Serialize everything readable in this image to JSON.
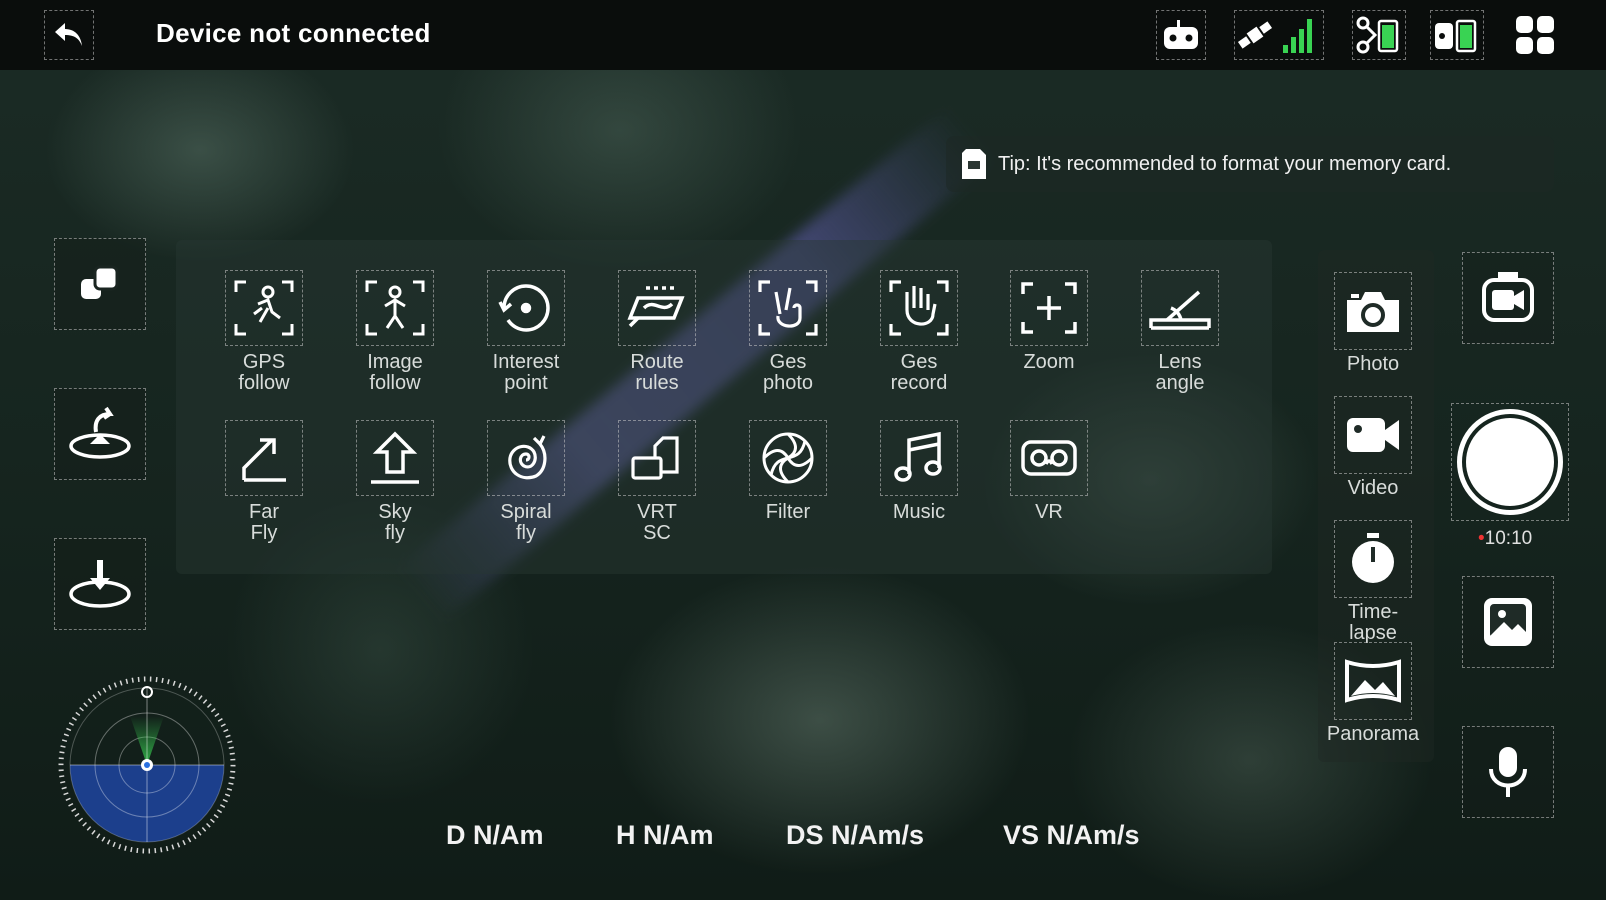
{
  "header": {
    "title": "Device not connected"
  },
  "top_icons": [
    "remote-controller-icon",
    "satellite-signal-icon",
    "drone-battery-icon",
    "controller-battery-icon",
    "grid-menu-icon"
  ],
  "tip": {
    "text": "Tip: It's recommended to format your memory card."
  },
  "left_buttons": [
    "switch-view-icon",
    "return-home-icon",
    "landing-icon"
  ],
  "modes": [
    {
      "label": "GPS\nfollow",
      "icon": "gps-follow-icon"
    },
    {
      "label": "Image\nfollow",
      "icon": "image-follow-icon"
    },
    {
      "label": "Interest\npoint",
      "icon": "interest-point-icon"
    },
    {
      "label": "Route\nrules",
      "icon": "route-rules-icon"
    },
    {
      "label": "Ges\nphoto",
      "icon": "gesture-photo-icon"
    },
    {
      "label": "Ges\nrecord",
      "icon": "gesture-record-icon"
    },
    {
      "label": "Zoom",
      "icon": "zoom-icon"
    },
    {
      "label": "Lens\nangle",
      "icon": "lens-angle-icon"
    },
    {
      "label": "Far\nFly",
      "icon": "far-fly-icon"
    },
    {
      "label": "Sky\nfly",
      "icon": "sky-fly-icon"
    },
    {
      "label": "Spiral\nfly",
      "icon": "spiral-fly-icon"
    },
    {
      "label": "VRT\nSC",
      "icon": "vrt-sc-icon"
    },
    {
      "label": "Filter",
      "icon": "filter-icon"
    },
    {
      "label": "Music",
      "icon": "music-icon"
    },
    {
      "label": "VR",
      "icon": "vr-icon"
    }
  ],
  "camera_modes": [
    {
      "label": "Photo",
      "icon": "camera-icon"
    },
    {
      "label": "Video",
      "icon": "video-icon"
    },
    {
      "label": "Time-\nlapse",
      "icon": "timer-icon"
    },
    {
      "label": "Panorama",
      "icon": "panorama-icon"
    }
  ],
  "record_timer": "10:10",
  "telemetry": {
    "distance": "D N/Am",
    "height": "H N/Am",
    "ds": "DS N/Am/s",
    "vs": "VS N/Am/s"
  },
  "colors": {
    "accent_green": "#39d353",
    "radar_blue": "#1c3f8c",
    "record_red": "#e33333"
  }
}
